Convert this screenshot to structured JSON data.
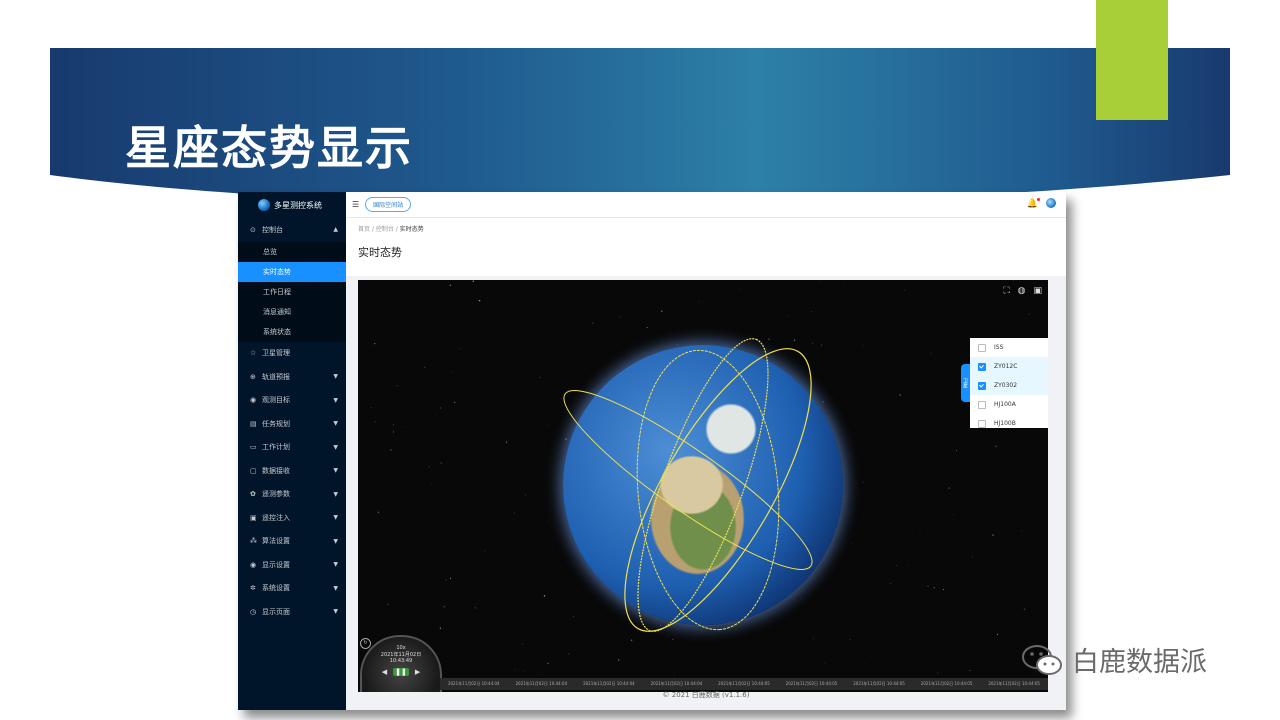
{
  "slide": {
    "title": "星座态势显示",
    "brand_text": "白鹿数据派",
    "brand_icon": "wechat-icon",
    "colors": {
      "accent": "#a8cf38",
      "banner": "#1f5a8e"
    }
  },
  "app": {
    "name": "多星测控系统",
    "tag": "国际空间站",
    "breadcrumb": [
      "首页",
      "控制台",
      "实时态势"
    ],
    "page_title": "实时态势",
    "footer": "© 2021 白鹿数据 (v1.1.6)"
  },
  "sidebar": {
    "control": {
      "label": "控制台",
      "icon": "dashboard-icon"
    },
    "submenu": [
      "总览",
      "实时态势",
      "工作日程",
      "消息通知",
      "系统状态"
    ],
    "items": [
      {
        "label": "卫星管理",
        "icon": "star-icon"
      },
      {
        "label": "轨道预报",
        "icon": "globe-icon"
      },
      {
        "label": "观测目标",
        "icon": "eye-icon"
      },
      {
        "label": "任务规划",
        "icon": "document-icon"
      },
      {
        "label": "工作计划",
        "icon": "file-icon"
      },
      {
        "label": "数据接收",
        "icon": "monitor-icon"
      },
      {
        "label": "遥测参数",
        "icon": "antenna-icon"
      },
      {
        "label": "遥控注入",
        "icon": "lock-icon"
      },
      {
        "label": "算法设置",
        "icon": "network-icon"
      },
      {
        "label": "显示设置",
        "icon": "eye-icon"
      },
      {
        "label": "系统设置",
        "icon": "gear-icon"
      },
      {
        "label": "显示页面",
        "icon": "clock-icon"
      }
    ]
  },
  "satellites": [
    {
      "name": "ISS",
      "checked": false
    },
    {
      "name": "ZY012C",
      "checked": true
    },
    {
      "name": "ZY0302",
      "checked": true
    },
    {
      "name": "HJ100A",
      "checked": false
    },
    {
      "name": "HJ100B",
      "checked": false
    }
  ],
  "panel_tab": "卫星",
  "clock": {
    "speed": "10x",
    "date": "2021年11月02日",
    "time": "10:43:49"
  },
  "timeline": [
    "2021年11月02日 10:44:04",
    "2021年11月02日 10:44:04",
    "2021年11月02日 10:44:04",
    "2021年11月02日 10:44:04",
    "2021年11月02日 10:44:05",
    "2021年11月02日 10:44:05",
    "2021年11月02日 10:44:05",
    "2021年11月02日 10:44:05",
    "2021年11月02日 10:44:05"
  ]
}
